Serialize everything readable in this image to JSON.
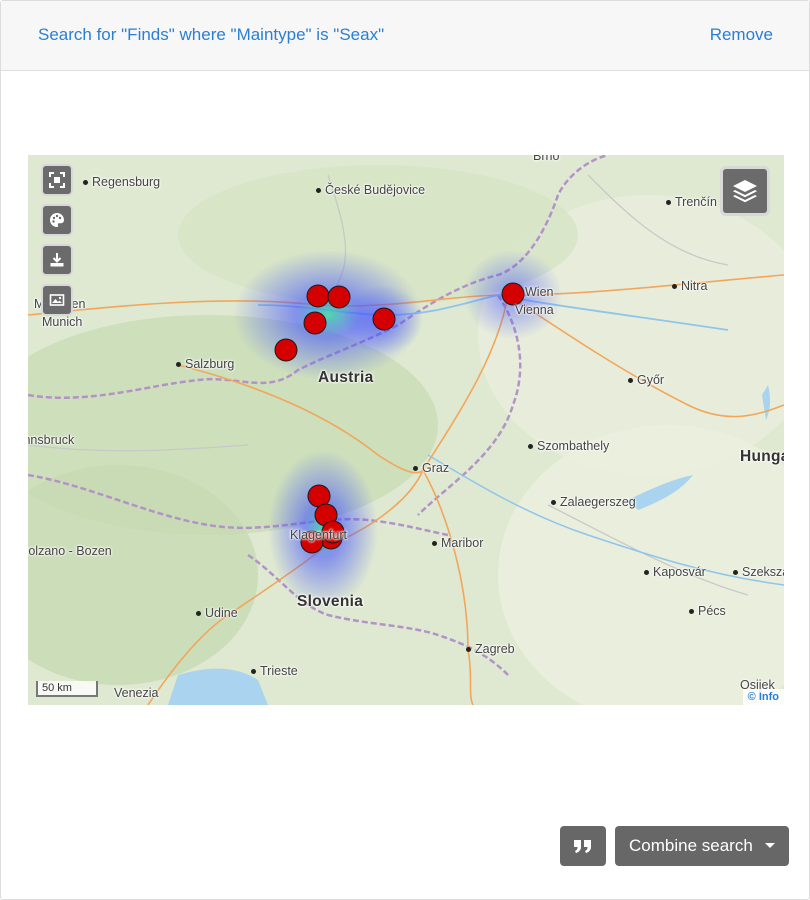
{
  "header": {
    "title": "Search for \"Finds\" where \"Maintype\" is \"Seax\"",
    "remove_label": "Remove"
  },
  "map": {
    "controls": [
      "fullscreen-icon",
      "palette-icon",
      "download-icon",
      "image-icon"
    ],
    "layers_icon": "layers-icon",
    "places": {
      "regensburg": "Regensburg",
      "budejovice": "České Budějovice",
      "trencin": "Trenčín",
      "brno": "Brno",
      "munich_a": "München",
      "munich_b": "Munich",
      "salzburg": "Salzburg",
      "austria": "Austria",
      "vienna_a": "Wien",
      "vienna_b": "Vienna",
      "nitra": "Nitra",
      "gyor": "Győr",
      "innsbruck": "Innsbruck",
      "szombathely": "Szombathely",
      "graz": "Graz",
      "hungary": "Hungary",
      "zalaegerszeg": "Zalaegerszeg",
      "bolzano": "Bolzano - Bozen",
      "klagenfurt": "Klagenfurt",
      "maribor": "Maribor",
      "kaposvar": "Kaposvár",
      "szekszard": "Szekszárd",
      "udine": "Udine",
      "slovenia": "Slovenia",
      "pecs": "Pécs",
      "zagreb": "Zagreb",
      "trieste": "Trieste",
      "venezia": "Venezia",
      "osijek": "Osijek"
    },
    "scale_label": "50 km",
    "attribution_label": "© Info",
    "marker_color": "#d40000",
    "heatmap_colors": [
      "#3b4bff",
      "#3fd9a8"
    ]
  },
  "footer": {
    "quote_icon": "quote-icon",
    "combine_label": "Combine search"
  }
}
